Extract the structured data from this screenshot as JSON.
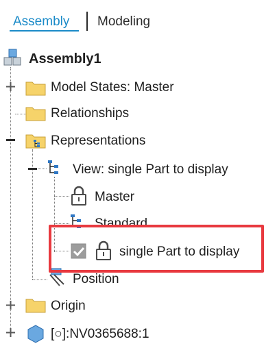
{
  "tabs": {
    "assembly": "Assembly",
    "modeling": "Modeling"
  },
  "tree": {
    "root": "Assembly1",
    "model_states": "Model States: Master",
    "relationships": "Relationships",
    "representations": "Representations",
    "view": "View: single Part to display",
    "master": "Master",
    "standard": "Standard",
    "single_part": "single Part to display",
    "position": "Position",
    "origin": "Origin",
    "component": "[○]:NV0365688:1"
  },
  "colors": {
    "accent": "#1a8ac8",
    "highlight": "#e8393f",
    "folder": "#f6d36a"
  }
}
